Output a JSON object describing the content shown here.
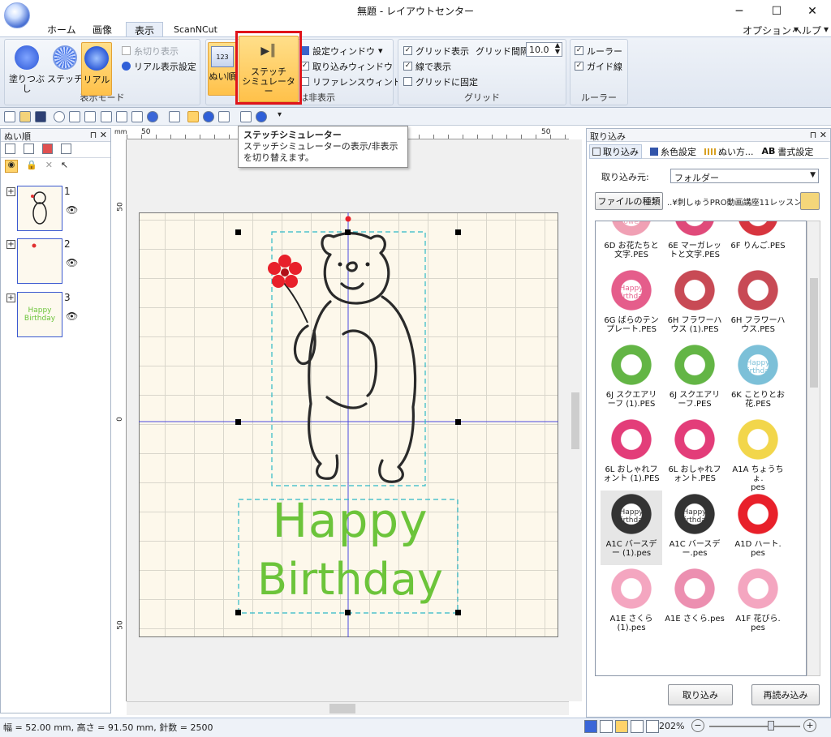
{
  "window": {
    "title": "無題 - レイアウトセンター",
    "minimize": "─",
    "maximize": "☐",
    "close": "✕"
  },
  "tabs": [
    {
      "label": "ホーム"
    },
    {
      "label": "画像"
    },
    {
      "label": "表示"
    },
    {
      "label": "ScanNCut"
    }
  ],
  "header_right": {
    "options": "オプション",
    "options_arrow": "▾",
    "help": "ヘルプ",
    "help_arrow": "▾"
  },
  "ribbon": {
    "display_mode": {
      "label": "表示モード",
      "fill": "塗りつぶし",
      "stitch": "ステッチ",
      "real": "リアル",
      "thread_cut": "糸切り表示",
      "real_setting": "リアル表示設定"
    },
    "show_hide": {
      "label": "表示または非表示",
      "sew_order": "ぬい順",
      "stitch_sim_line1": "ステッチ",
      "stitch_sim_line2": "シミュレーター",
      "settings_window": "設定ウィンドウ",
      "settings_arrow": "▾",
      "import_window": "取り込みウィンドウ",
      "reference_window": "リファレンスウィンドウ"
    },
    "grid": {
      "label": "グリッド",
      "show_grid": "グリッド表示",
      "interval_label": "グリッド間隔:",
      "interval_value": "10.0",
      "line_display": "線で表示",
      "snap_grid": "グリッドに固定"
    },
    "ruler": {
      "label": "ルーラー",
      "ruler": "ルーラー",
      "guide": "ガイド線"
    }
  },
  "tooltip": {
    "title": "ステッチシミュレーター",
    "body": "ステッチシミュレーターの表示/非表示を切り替えます。"
  },
  "left_panel": {
    "title": "ぬい順",
    "pin": "⊓",
    "close": "✕",
    "items": [
      {
        "num": "1",
        "text_line1": "",
        "text_line2": ""
      },
      {
        "num": "2",
        "text_line1": "",
        "text_line2": ""
      },
      {
        "num": "3",
        "text_line1": "Happy",
        "text_line2": "Birthday"
      }
    ]
  },
  "ruler": {
    "unit": "mm",
    "h_ticks": [
      "50",
      "0",
      "50"
    ],
    "v_ticks": [
      "50",
      "0",
      "50"
    ]
  },
  "design": {
    "line1": "Happy",
    "line2": "Birthday",
    "text_color": "#6cc43a",
    "flower_color": "#e8202a"
  },
  "right_panel": {
    "title": "取り込み",
    "pin": "⊓",
    "close": "✕",
    "tabs": [
      {
        "label": "取り込み"
      },
      {
        "label": "糸色設定"
      },
      {
        "label": "ぬい方..."
      },
      {
        "label": "書式設定"
      }
    ],
    "tab_icon_ab": "AB",
    "source_label": "取り込み元:",
    "source_value": "フォルダー",
    "dropdown_arrow": "▼",
    "file_type_button": "ファイルの種類",
    "path": "..¥刺しゅうPRO動画講座11レッスン",
    "tiles": [
      {
        "label_line1": "6D お花たちと",
        "label_line2": "文字.PES",
        "art": "Pretty Flowers"
      },
      {
        "label_line1": "6E マーガレッ",
        "label_line2": "トと文字.PES",
        "art": "Flower"
      },
      {
        "label_line1": "6F りんご.PES",
        "label_line2": "",
        "art": "apple"
      },
      {
        "label_line1": "6G ばらのテン",
        "label_line2": "プレート.PES",
        "art": "Happy Birthday"
      },
      {
        "label_line1": "6H フラワーハ",
        "label_line2": "ウス (1).PES",
        "art": ""
      },
      {
        "label_line1": "6H フラワーハ",
        "label_line2": "ウス.PES",
        "art": ""
      },
      {
        "label_line1": "6J スクエアリ",
        "label_line2": "ーフ (1).PES",
        "art": ""
      },
      {
        "label_line1": "6J スクエアリ",
        "label_line2": "ーフ.PES",
        "art": ""
      },
      {
        "label_line1": "6K ことりとお",
        "label_line2": "花.PES",
        "art": "Happy Birthday"
      },
      {
        "label_line1": "6L おしゃれフ",
        "label_line2": "ォント (1).PES",
        "art": ""
      },
      {
        "label_line1": "6L おしゃれフ",
        "label_line2": "ォント.PES",
        "art": ""
      },
      {
        "label_line1": "A1A ちょうちょ.",
        "label_line2": "pes",
        "art": ""
      },
      {
        "label_line1": "A1C バースデ",
        "label_line2": "ー (1).pes",
        "art": "Happy Birthday"
      },
      {
        "label_line1": "A1C バースデ",
        "label_line2": "ー.pes",
        "art": "Happy Birthday"
      },
      {
        "label_line1": "A1D ハート.",
        "label_line2": "pes",
        "art": ""
      },
      {
        "label_line1": "A1E さくら",
        "label_line2": "(1).pes",
        "art": ""
      },
      {
        "label_line1": "A1E さくら.pes",
        "label_line2": "",
        "art": ""
      },
      {
        "label_line1": "A1F 花びら.",
        "label_line2": "pes",
        "art": ""
      }
    ],
    "import_button": "取り込み",
    "reload_button": "再読み込み"
  },
  "statusbar": {
    "info": "幅 = 52.00 mm, 高さ = 91.50 mm, 針数 = 2500",
    "zoom": "202%",
    "zoom_minus": "−",
    "zoom_plus": "+"
  }
}
